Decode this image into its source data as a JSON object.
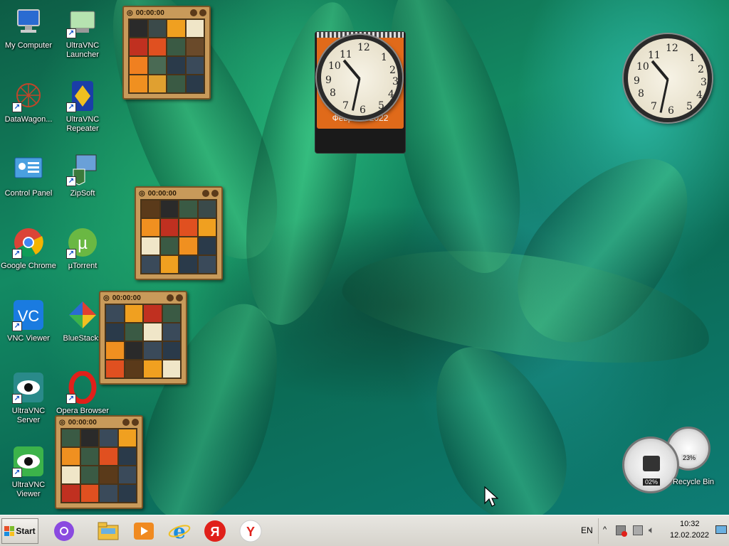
{
  "desktop": {
    "icons": [
      {
        "name": "my-computer-icon",
        "label": "My Computer"
      },
      {
        "name": "ultravnc-launcher-icon",
        "label": "UltraVNC Launcher"
      },
      {
        "name": "datawagon-icon",
        "label": "DataWagon..."
      },
      {
        "name": "ultravnc-repeater-icon",
        "label": "UltraVNC Repeater"
      },
      {
        "name": "control-panel-icon",
        "label": "Control Panel"
      },
      {
        "name": "zipsoft-icon",
        "label": "ZipSoft"
      },
      {
        "name": "google-chrome-icon",
        "label": "Google Chrome"
      },
      {
        "name": "utorrent-icon",
        "label": "µTorrent"
      },
      {
        "name": "vnc-viewer-icon",
        "label": "VNC Viewer"
      },
      {
        "name": "bluestacks-icon",
        "label": "BlueStacks"
      },
      {
        "name": "ultravnc-server-icon",
        "label": "UltraVNC Server"
      },
      {
        "name": "opera-browser-icon",
        "label": "Opera Browser"
      },
      {
        "name": "ultravnc-viewer-icon",
        "label": "UltraVNC Viewer"
      },
      {
        "name": "recycle-bin-icon",
        "label": "Recycle Bin"
      }
    ]
  },
  "puzzles": [
    {
      "timer": "00:00:00"
    },
    {
      "timer": "00:00:00"
    },
    {
      "timer": "00:00:00"
    },
    {
      "timer": "00:00:00"
    }
  ],
  "calendar_clock": {
    "date_text": "Февраль 2022"
  },
  "cpu_gauge": {
    "cpu": "02%",
    "mem": "23%"
  },
  "taskbar": {
    "start_label": "Start",
    "lang": "EN",
    "time": "10:32",
    "date": "12.02.2022"
  },
  "colors": {
    "taskbar_bg": "#e8e6e1",
    "accent_orange": "#e06a1a"
  }
}
